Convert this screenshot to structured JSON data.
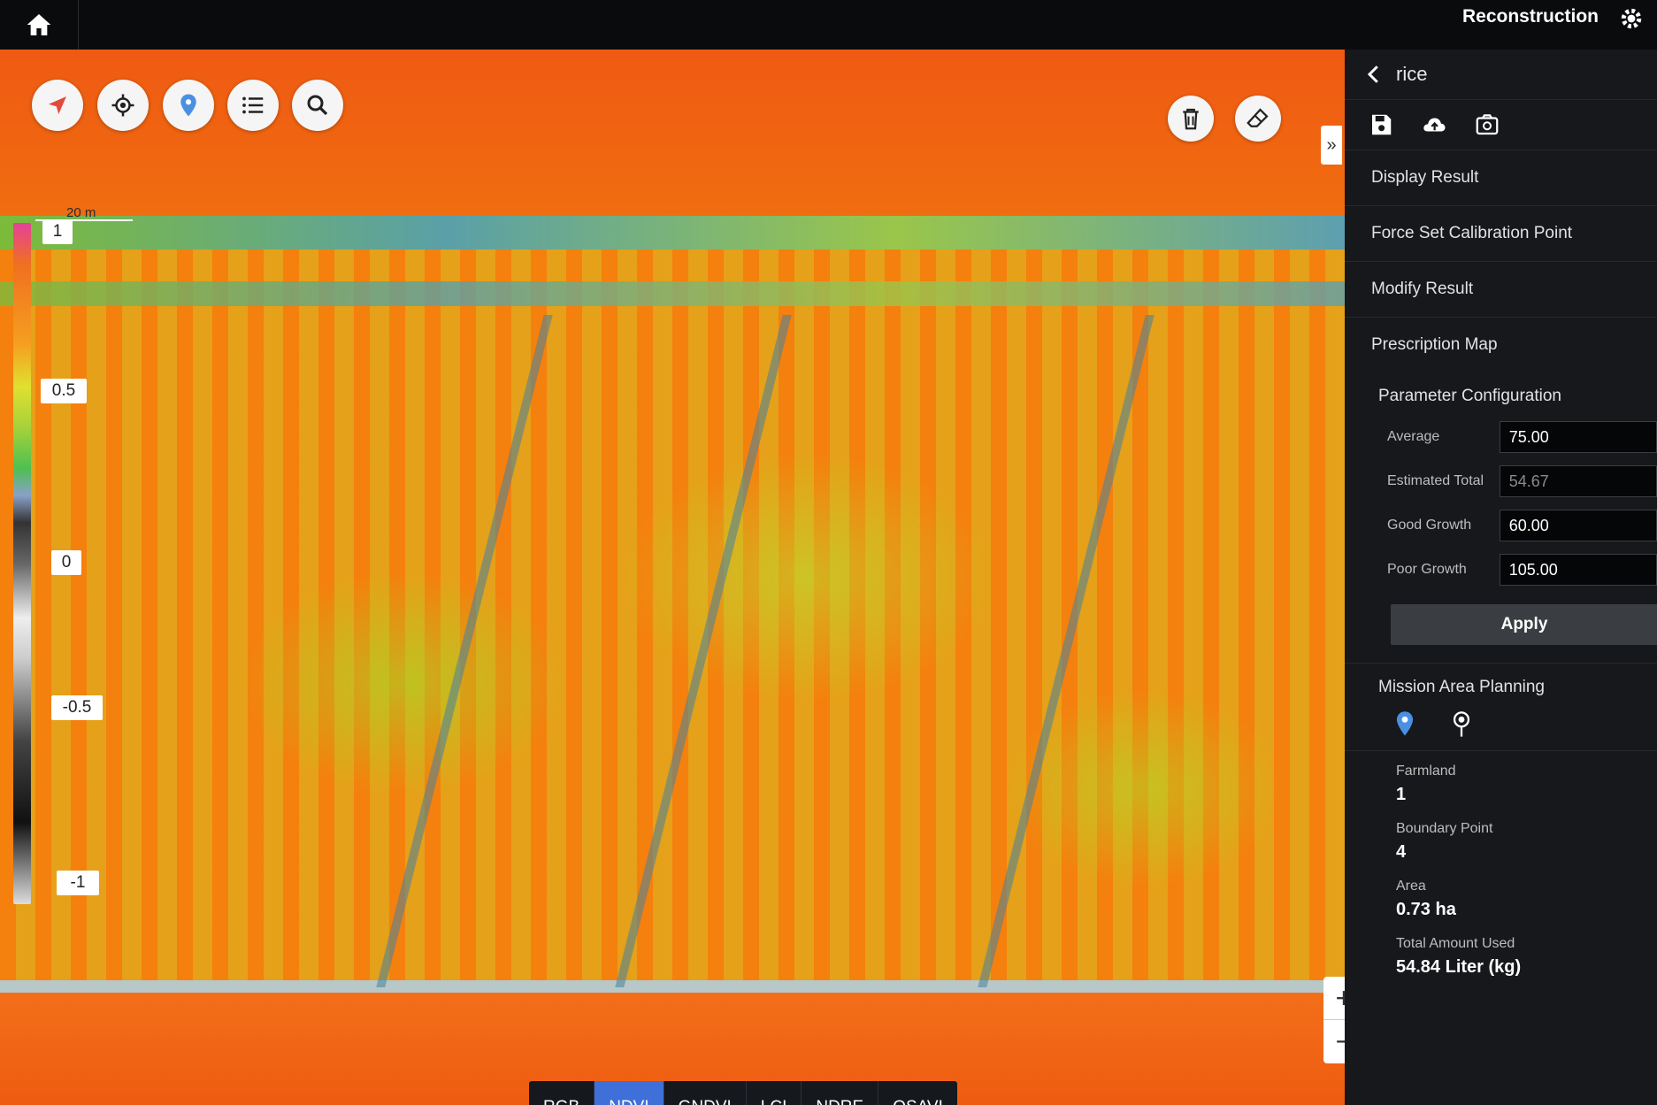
{
  "app": {
    "title": "Reconstruction"
  },
  "map": {
    "scale_label": "20 m",
    "legend": {
      "labels": [
        "1",
        "0.5",
        "0",
        "-0.5",
        "-1"
      ]
    },
    "bands": [
      {
        "label": "RGB",
        "active": false
      },
      {
        "label": "NDVI",
        "active": true
      },
      {
        "label": "GNDVI",
        "active": false
      },
      {
        "label": "LCI",
        "active": false
      },
      {
        "label": "NDRE",
        "active": false
      },
      {
        "label": "OSAVI",
        "active": false
      }
    ],
    "expand_label": "»",
    "zoom_in": "+",
    "zoom_out": "−"
  },
  "panel": {
    "title": "rice",
    "menu": [
      {
        "label": "Display Result"
      },
      {
        "label": "Force Set Calibration Point"
      },
      {
        "label": "Modify Result"
      },
      {
        "label": "Prescription Map"
      }
    ],
    "parameter_section": "Parameter Configuration",
    "params": [
      {
        "label": "Average",
        "value": "75.00",
        "readonly": false
      },
      {
        "label": "Estimated Total",
        "value": "54.67",
        "readonly": true
      },
      {
        "label": "Good Growth",
        "value": "60.00",
        "readonly": false
      },
      {
        "label": "Poor Growth",
        "value": "105.00",
        "readonly": false
      }
    ],
    "apply_label": "Apply",
    "mission_section": "Mission Area Planning",
    "farmland_label": "Farmland",
    "farmland_value": "1",
    "boundary_label": "Boundary Point",
    "boundary_value": "4",
    "area_label": "Area",
    "area_value": "0.73 ha",
    "total_label": "Total Amount Used",
    "total_value": "54.84 Liter (kg)"
  },
  "colors": {
    "active_band": "#3f6fd8",
    "pin_blue": "#4a90e2"
  }
}
